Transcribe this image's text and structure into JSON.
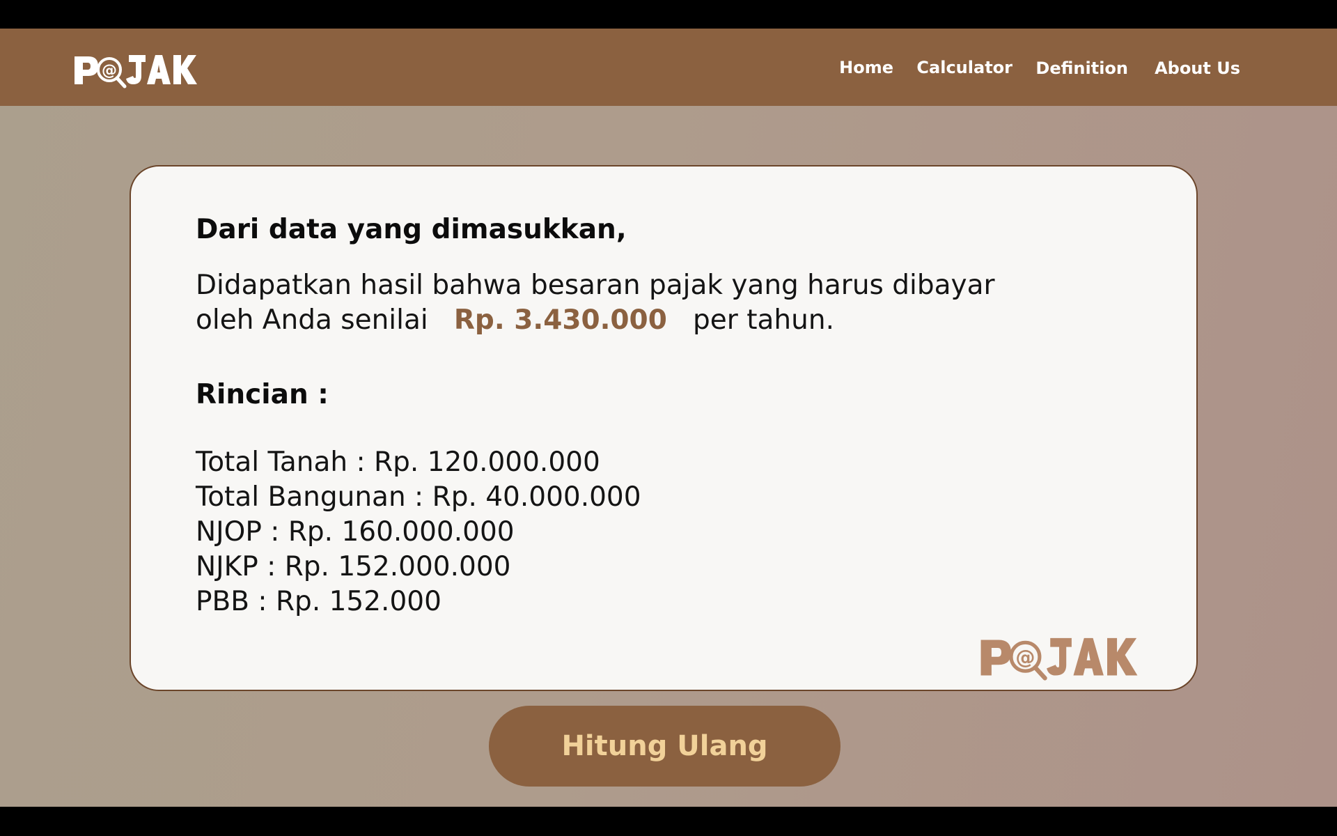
{
  "brand": {
    "logo_text": "PaJAK",
    "colors": {
      "primary": "#8b6140",
      "button_text": "#f1d199",
      "card_bg": "#f8f7f5",
      "logo_light": "#ffffff",
      "logo_muted": "#b8896a"
    }
  },
  "nav": {
    "items": [
      {
        "label": "Home"
      },
      {
        "label": "Calculator"
      },
      {
        "label": "Definition"
      },
      {
        "label": "About Us"
      }
    ]
  },
  "result": {
    "heading": "Dari data yang dimasukkan,",
    "line1": "Didapatkan hasil bahwa besaran pajak yang harus dibayar",
    "line2_prefix": "oleh Anda senilai",
    "amount": "Rp. 3.430.000",
    "line2_suffix": "per tahun."
  },
  "details": {
    "title": "Rincian :",
    "items": [
      {
        "text": "Total Tanah : Rp. 120.000.000"
      },
      {
        "text": "Total Bangunan : Rp. 40.000.000"
      },
      {
        "text": "NJOP : Rp. 160.000.000"
      },
      {
        "text": "NJKP : Rp. 152.000.000"
      },
      {
        "text": "PBB : Rp. 152.000"
      }
    ]
  },
  "actions": {
    "recalculate_label": "Hitung Ulang"
  },
  "icons": {
    "logo_magnifier": "magnifier-at-icon"
  }
}
